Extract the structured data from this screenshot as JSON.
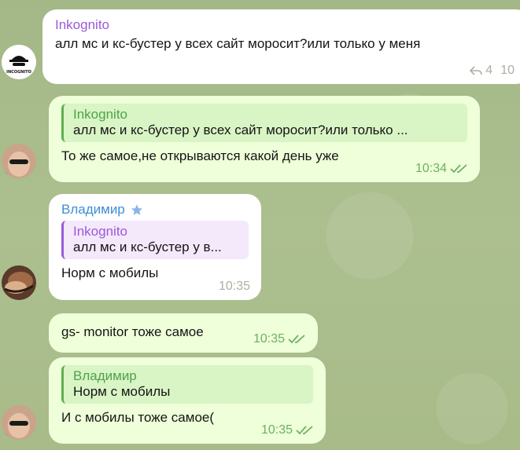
{
  "messages": [
    {
      "sender": "Inkognito",
      "text": "алл мс и кс-бустер у всех сайт моросит?или только у меня",
      "replies": "4",
      "time": "10",
      "avatar_label": "INCOGNITO"
    },
    {
      "quote_name": "Inkognito",
      "quote_text": "алл мс и кс-бустер у всех сайт моросит?или только ...",
      "text": "То же самое,не открываются какой день уже",
      "time": "10:34"
    },
    {
      "sender": "Владимир",
      "quote_name": "Inkognito",
      "quote_text": "алл мс и кс-бустер у в...",
      "text": "Норм с мобилы",
      "time": "10:35"
    },
    {
      "text": "gs- monitor тоже самое",
      "time": "10:35"
    },
    {
      "quote_name": "Владимир",
      "quote_text": "Норм с мобилы",
      "text": "И с мобилы тоже самое(",
      "time": "10:35"
    }
  ],
  "colors": {
    "sender_violet": "#9b59d8",
    "sender_blue": "#3d8fd1",
    "quote_green": "#4ea34a",
    "check_green": "#6fb062",
    "out_bubble": "#eeffd9"
  },
  "icons": [
    "reply-icon",
    "star-icon",
    "double-check-icon"
  ]
}
